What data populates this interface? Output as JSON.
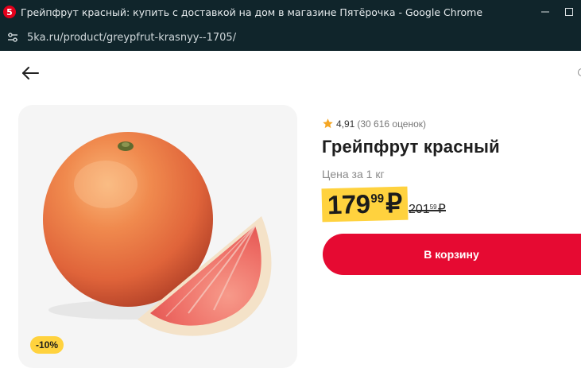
{
  "window": {
    "favicon_text": "5",
    "title": "Грейпфрут красный: купить с доставкой на дом в магазине Пятёрочка - Google Chrome"
  },
  "addressbar": {
    "url": "5ka.ru/product/greypfrut-krasnyy--1705/"
  },
  "product": {
    "rating_value": "4,91",
    "rating_count": "(30 616 оценок)",
    "title": "Грейпфрут красный",
    "price_unit": "Цена за 1 кг",
    "price": {
      "integer": "179",
      "decimal": "99",
      "currency": "₽"
    },
    "old_price": {
      "integer": "201",
      "decimal": "59",
      "currency": "₽"
    },
    "discount": "-10%",
    "cart_button_label": "В корзину"
  },
  "colors": {
    "brand_red": "#e60a32",
    "price_yellow": "#ffd23e",
    "chrome_dark": "#10252b"
  },
  "icons": [
    "site-info-icon",
    "back-arrow-icon",
    "star-icon",
    "minimize-icon",
    "maximize-icon"
  ]
}
